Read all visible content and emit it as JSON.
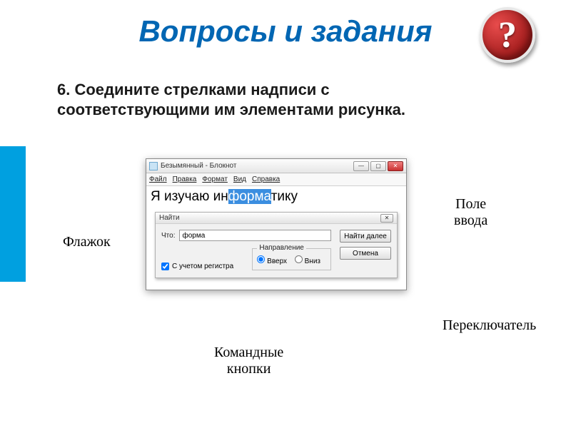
{
  "title": "Вопросы и задания",
  "help_icon": "?",
  "instruction": "6. Соедините стрелками надписи с соответствующими им элементами рисунка.",
  "labels": {
    "flag": "Флажок",
    "input_field_l1": "Поле",
    "input_field_l2": "ввода",
    "switch": "Переключатель",
    "cmd_buttons_l1": "Командные",
    "cmd_buttons_l2": "кнопки"
  },
  "notepad": {
    "window_title": "Безымянный - Блокнот",
    "menu": {
      "file": "Файл",
      "edit": "Правка",
      "format": "Формат",
      "view": "Вид",
      "help": "Справка"
    },
    "text_pre": "Я изучаю ин",
    "text_sel": "форма",
    "text_post": "тику",
    "find": {
      "title": "Найти",
      "what_label": "Что:",
      "what_value": "форма",
      "find_next": "Найти далее",
      "cancel": "Отмена",
      "direction_label": "Направление",
      "up": "Вверх",
      "down": "Вниз",
      "case": "С учетом регистра"
    },
    "winbtn": {
      "min": "—",
      "max": "▢",
      "close": "✕"
    }
  }
}
